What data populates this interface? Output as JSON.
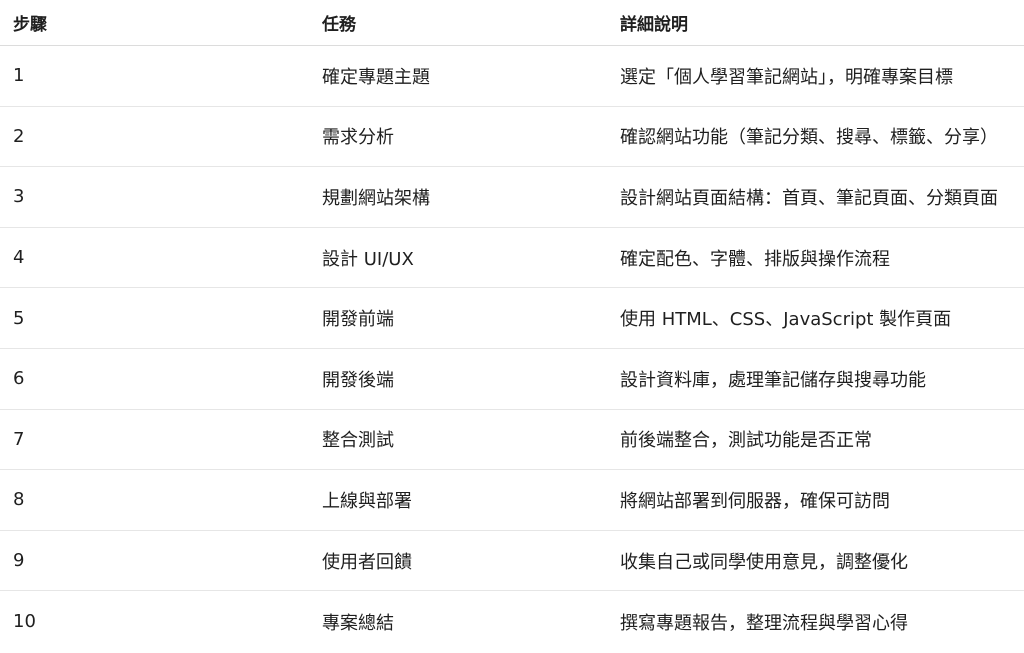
{
  "table": {
    "headers": [
      "步驟",
      "任務",
      "詳細說明"
    ],
    "rows": [
      {
        "step": "1",
        "task": "確定專題主題",
        "detail": "選定「個人學習筆記網站」，明確專案目標"
      },
      {
        "step": "2",
        "task": "需求分析",
        "detail": "確認網站功能（筆記分類、搜尋、標籤、分享）"
      },
      {
        "step": "3",
        "task": "規劃網站架構",
        "detail": "設計網站頁面結構：首頁、筆記頁面、分類頁面"
      },
      {
        "step": "4",
        "task": "設計 UI/UX",
        "detail": "確定配色、字體、排版與操作流程"
      },
      {
        "step": "5",
        "task": "開發前端",
        "detail": "使用 HTML、CSS、JavaScript 製作頁面"
      },
      {
        "step": "6",
        "task": "開發後端",
        "detail": "設計資料庫，處理筆記儲存與搜尋功能"
      },
      {
        "step": "7",
        "task": "整合測試",
        "detail": "前後端整合，測試功能是否正常"
      },
      {
        "step": "8",
        "task": "上線與部署",
        "detail": "將網站部署到伺服器，確保可訪問"
      },
      {
        "step": "9",
        "task": "使用者回饋",
        "detail": "收集自己或同學使用意見，調整優化"
      },
      {
        "step": "10",
        "task": "專案總結",
        "detail": "撰寫專題報告，整理流程與學習心得"
      }
    ]
  }
}
